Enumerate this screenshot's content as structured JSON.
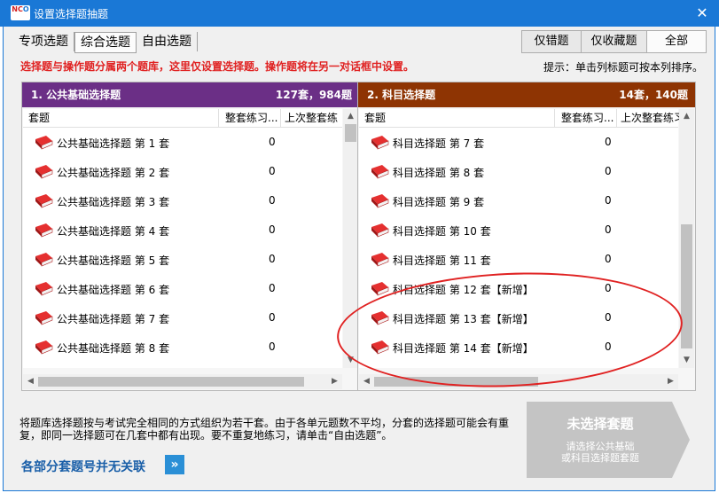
{
  "window": {
    "title": "设置选择题抽题",
    "logo_text_a": "NC",
    "logo_text_b": "O",
    "close_glyph": "✕"
  },
  "tabs": [
    {
      "label": "专项选题"
    },
    {
      "label": "综合选题"
    },
    {
      "label": "自由选题"
    }
  ],
  "filters": [
    {
      "label": "仅错题"
    },
    {
      "label": "仅收藏题"
    },
    {
      "label": "全部"
    }
  ],
  "warning": "选择题与操作题分属两个题库，这里仅设置选择题。操作题将在另一对话框中设置。",
  "hint": "提示：单击列标题可按本列排序。",
  "left_group": {
    "header_num": "1. 公共基础选择题",
    "header_count": "127套，984题",
    "columns": [
      "套题",
      "整套练习...",
      "上次整套练"
    ],
    "rows": [
      {
        "name": "公共基础选择题 第 1 套",
        "count": "0"
      },
      {
        "name": "公共基础选择题 第 2 套",
        "count": "0"
      },
      {
        "name": "公共基础选择题 第 3 套",
        "count": "0"
      },
      {
        "name": "公共基础选择题 第 4 套",
        "count": "0"
      },
      {
        "name": "公共基础选择题 第 5 套",
        "count": "0"
      },
      {
        "name": "公共基础选择题 第 6 套",
        "count": "0"
      },
      {
        "name": "公共基础选择题 第 7 套",
        "count": "0"
      },
      {
        "name": "公共基础选择题 第 8 套",
        "count": "0"
      }
    ]
  },
  "right_group": {
    "header_num": "2. 科目选择题",
    "header_count": "14套，140题",
    "columns": [
      "套题",
      "整套练习...",
      "上次整套练习"
    ],
    "rows": [
      {
        "name": "科目选择题 第 7 套",
        "count": "0"
      },
      {
        "name": "科目选择题 第 8 套",
        "count": "0"
      },
      {
        "name": "科目选择题 第 9 套",
        "count": "0"
      },
      {
        "name": "科目选择题 第 10 套",
        "count": "0"
      },
      {
        "name": "科目选择题 第 11 套",
        "count": "0"
      },
      {
        "name": "科目选择题 第 12 套【新增】",
        "count": "0"
      },
      {
        "name": "科目选择题 第 13 套【新增】",
        "count": "0"
      },
      {
        "name": "科目选择题 第 14 套【新增】",
        "count": "0"
      }
    ]
  },
  "info": "将题库选择题按与考试完全相同的方式组织为若干套。由于各单元题数不平均，分套的选择题可能会有重复，即同一选择题可在几套中都有出现。要不重复地练习，请单击“自由选题”。",
  "link": {
    "label": "各部分套题号并无关联",
    "button": "»"
  },
  "start_button": {
    "title": "未选择套题",
    "subtitle": "请选择公共基础\n或科目选择题套题"
  },
  "colors": {
    "title_bar": "#1a78d6",
    "left_header": "#6b2f86",
    "right_header": "#8e3403",
    "warning": "#e02222",
    "start_button": "#c4c4c4"
  }
}
